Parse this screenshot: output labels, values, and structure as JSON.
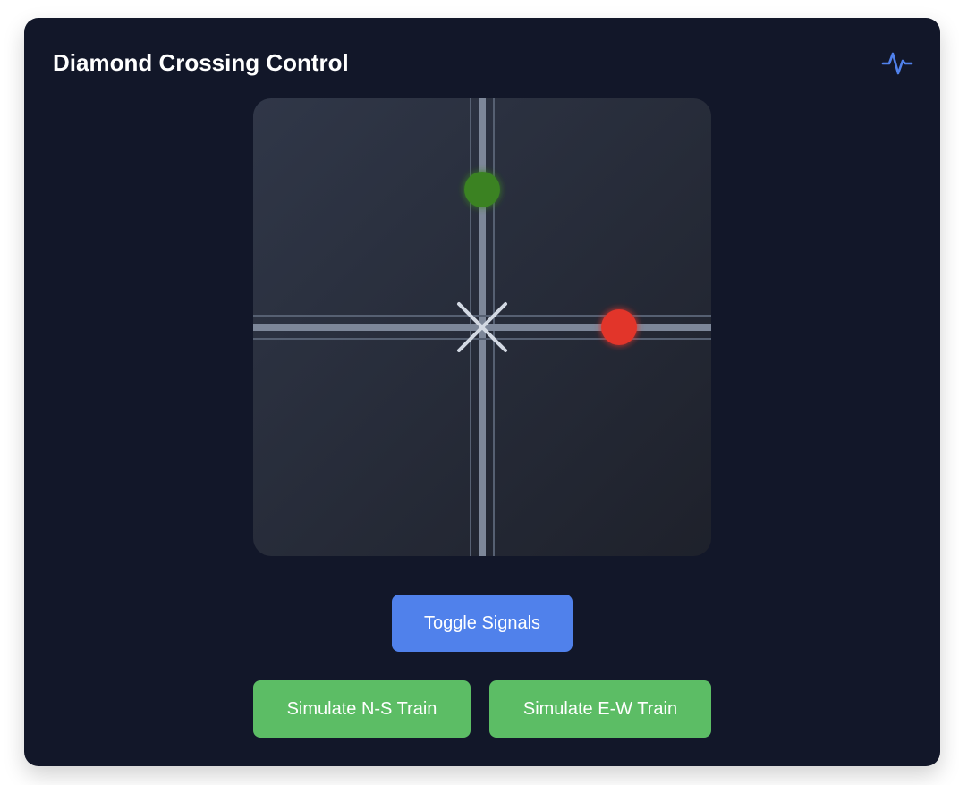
{
  "header": {
    "title": "Diamond Crossing Control",
    "icon": "activity-icon",
    "icon_color": "#5081eb"
  },
  "crossing": {
    "signals": [
      {
        "track": "north-south",
        "state": "green",
        "color": "#3a8224"
      },
      {
        "track": "east-west",
        "state": "red",
        "color": "#e2352b"
      }
    ],
    "track_color": "#7d8799",
    "center_mark_color": "#d3d9e3"
  },
  "controls": {
    "toggle_label": "Toggle Signals",
    "ns_train_label": "Simulate N-S Train",
    "ew_train_label": "Simulate E-W Train",
    "toggle_color": "#5081eb",
    "train_color": "#5cbd65"
  }
}
